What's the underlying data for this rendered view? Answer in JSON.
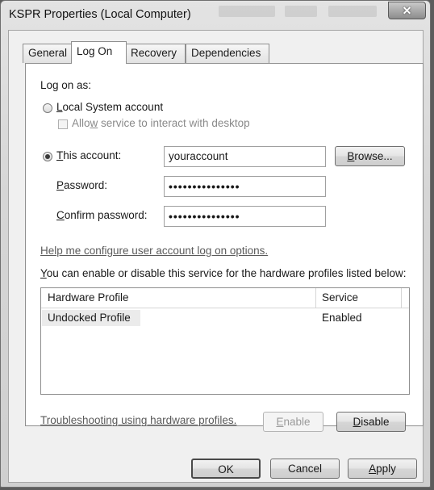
{
  "window": {
    "title": "KSPR Properties (Local Computer)",
    "close_glyph": "✕"
  },
  "tabs": [
    {
      "label": "General",
      "active": false
    },
    {
      "label": "Log On",
      "active": true
    },
    {
      "label": "Recovery",
      "active": false
    },
    {
      "label": "Dependencies",
      "active": false
    }
  ],
  "logon": {
    "heading": "Log on as:",
    "local_system": {
      "label_key": "L",
      "label_rest": "ocal System account",
      "selected": false
    },
    "allow_interact": {
      "label_pre": "Allo",
      "label_key": "w",
      "label_rest": " service to interact with desktop",
      "checked": false,
      "enabled": false
    },
    "this_account": {
      "label_key": "T",
      "label_rest": "his account:",
      "selected": true,
      "value": "youraccount"
    },
    "browse": {
      "label_key": "B",
      "label_rest": "rowse..."
    },
    "password": {
      "label_key": "P",
      "label_rest": "assword:",
      "value": "•••••••••••••••"
    },
    "confirm": {
      "label_key": "C",
      "label_rest": "onfirm password:",
      "value": "•••••••••••••••"
    },
    "help_link": "Help me configure user account log on options."
  },
  "hardware": {
    "description_key": "Y",
    "description_rest": "ou can enable or disable this service for the hardware profiles listed below:",
    "columns": [
      "Hardware Profile",
      "Service"
    ],
    "rows": [
      {
        "profile": "Undocked Profile",
        "service": "Enabled"
      }
    ],
    "troubleshoot_link": "Troubleshooting using hardware profiles.",
    "enable": {
      "label_key": "E",
      "label_rest": "nable",
      "enabled": false
    },
    "disable": {
      "label_key": "D",
      "label_rest": "isable",
      "enabled": true
    }
  },
  "footer": {
    "ok": "OK",
    "cancel": "Cancel",
    "apply": {
      "label_key": "A",
      "label_rest": "pply"
    }
  }
}
